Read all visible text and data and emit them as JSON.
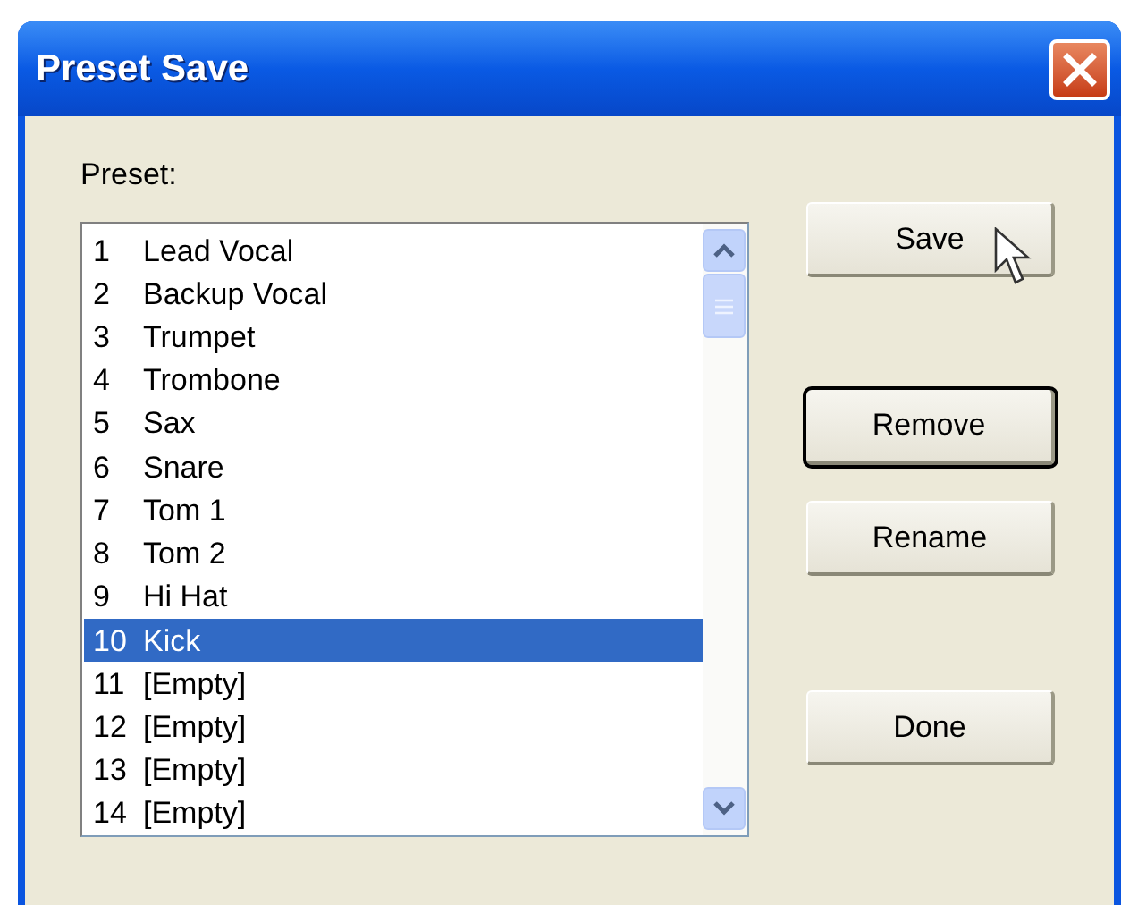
{
  "window": {
    "title": "Preset Save"
  },
  "preset_label": "Preset:",
  "presets": [
    {
      "number": "1",
      "name": "Lead Vocal",
      "selected": false
    },
    {
      "number": "2",
      "name": "Backup Vocal",
      "selected": false
    },
    {
      "number": "3",
      "name": "Trumpet",
      "selected": false
    },
    {
      "number": "4",
      "name": "Trombone",
      "selected": false
    },
    {
      "number": "5",
      "name": "Sax",
      "selected": false
    },
    {
      "number": "6",
      "name": "Snare",
      "selected": false
    },
    {
      "number": "7",
      "name": "Tom 1",
      "selected": false
    },
    {
      "number": "8",
      "name": "Tom 2",
      "selected": false
    },
    {
      "number": "9",
      "name": "Hi Hat",
      "selected": false
    },
    {
      "number": "10",
      "name": "Kick",
      "selected": true
    },
    {
      "number": "11",
      "name": "[Empty]",
      "selected": false
    },
    {
      "number": "12",
      "name": "[Empty]",
      "selected": false
    },
    {
      "number": "13",
      "name": "[Empty]",
      "selected": false
    },
    {
      "number": "14",
      "name": "[Empty]",
      "selected": false
    }
  ],
  "buttons": [
    {
      "label": "Save",
      "default": false,
      "hovered": true
    },
    {
      "label": "Remove",
      "default": true,
      "hovered": false
    },
    {
      "label": "Rename",
      "default": false,
      "hovered": false
    },
    {
      "label": "Done",
      "default": false,
      "hovered": false
    }
  ]
}
